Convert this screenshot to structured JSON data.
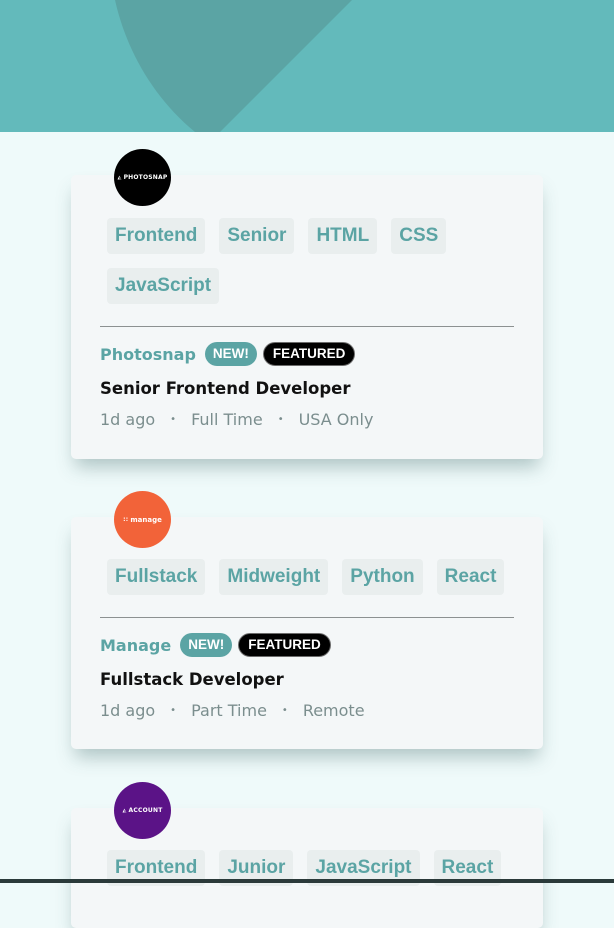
{
  "colors": {
    "header_bg": "#63babb",
    "page_bg": "#effafa",
    "card_bg": "#f4f7f8",
    "accent": "#5ba4a4"
  },
  "listings": [
    {
      "logo": {
        "text": "PHOTOSNAP",
        "glyph": "◭",
        "bg": "#000000"
      },
      "tags": [
        "Frontend",
        "Senior",
        "HTML",
        "CSS",
        "JavaScript"
      ],
      "company": "Photosnap",
      "new_label": "NEW!",
      "featured_label": "FEATURED",
      "position": "Senior Frontend Developer",
      "posted": "1d ago",
      "contract": "Full Time",
      "location": "USA Only"
    },
    {
      "logo": {
        "text": "manage",
        "glyph": "::",
        "bg": "#f26339"
      },
      "tags": [
        "Fullstack",
        "Midweight",
        "Python",
        "React"
      ],
      "company": "Manage",
      "new_label": "NEW!",
      "featured_label": "FEATURED",
      "position": "Fullstack Developer",
      "posted": "1d ago",
      "contract": "Part Time",
      "location": "Remote"
    },
    {
      "logo": {
        "text": "ACCOUNT",
        "glyph": "◭",
        "bg": "#5b1387"
      },
      "tags": [
        "Frontend",
        "Junior",
        "JavaScript",
        "React"
      ]
    }
  ],
  "separator": "•"
}
